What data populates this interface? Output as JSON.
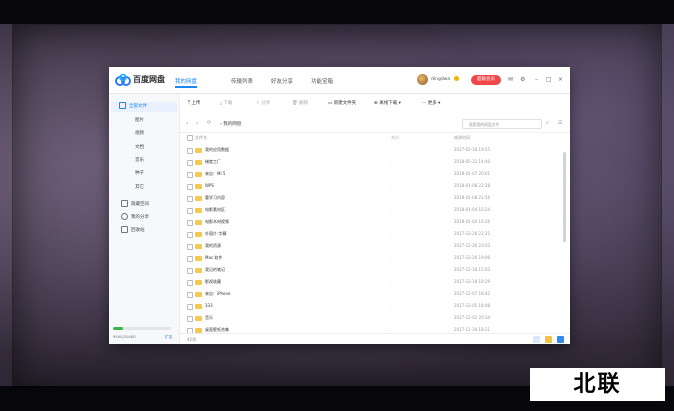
{
  "app": {
    "name": "百度网盘",
    "tabs": [
      "我的网盘",
      "传输列表",
      "好友分享",
      "功能宝箱"
    ],
    "active_tab": 0,
    "user": {
      "name": "dingdwa",
      "member_button": "超级会员"
    }
  },
  "sidebar": {
    "items": [
      "全部文件",
      "图片",
      "视频",
      "文档",
      "音乐",
      "种子",
      "其它",
      "隐藏空间",
      "我的分享",
      "回收站"
    ],
    "active": 0,
    "quota_text": "956G/2048G",
    "quota_fraction": 0.18,
    "expand_label": "扩容"
  },
  "toolbar": {
    "upload": "上传",
    "download": "下载",
    "share": "分享",
    "delete": "删除",
    "new_folder": "新建文件夹",
    "offline_download": "离线下载",
    "more": "更多"
  },
  "path": {
    "current": "我的网盘",
    "search_placeholder": "搜索我的网盘文件"
  },
  "columns": {
    "name": "文件名",
    "size": "大小",
    "modified": "修改时间"
  },
  "files": [
    {
      "name": "我的应用数据",
      "size": "-",
      "date": "2017-02-18 19:55"
    },
    {
      "name": "梯度工厂",
      "size": "-",
      "date": "2018-05-22 14:40"
    },
    {
      "name": "来自：Mi 5",
      "size": "-",
      "date": "2018-01-07 20:01"
    },
    {
      "name": "WPS",
      "size": "-",
      "date": "2018-01-08 22:28"
    },
    {
      "name": "重学习内容",
      "size": "-",
      "date": "2018-01-08 21:56"
    },
    {
      "name": "电影素材区",
      "size": "-",
      "date": "2018-01-04 16:24"
    },
    {
      "name": "电影木材视频",
      "size": "-",
      "date": "2018-01-04 16:26"
    },
    {
      "name": "外国片-字幕",
      "size": "-",
      "date": "2017-12-26 22:25"
    },
    {
      "name": "我的资源",
      "size": "-",
      "date": "2017-12-26 23:03"
    },
    {
      "name": "Mac 软件",
      "size": "-",
      "date": "2017-12-26 19:06"
    },
    {
      "name": "我记的笔记",
      "size": "-",
      "date": "2017-12-18 15:03"
    },
    {
      "name": "影视收藏",
      "size": "-",
      "date": "2017-12-18 18:29"
    },
    {
      "name": "来自：iPhone",
      "size": "-",
      "date": "2017-12-07 18:42"
    },
    {
      "name": "333",
      "size": "-",
      "date": "2017-12-05 18:48"
    },
    {
      "name": "音乐",
      "size": "-",
      "date": "2017-12-02 20:34"
    },
    {
      "name": "桌面壁纸合集",
      "size": "-",
      "date": "2017-11-30 18:21"
    }
  ],
  "status": {
    "count": "42项"
  },
  "watermark": "北联"
}
